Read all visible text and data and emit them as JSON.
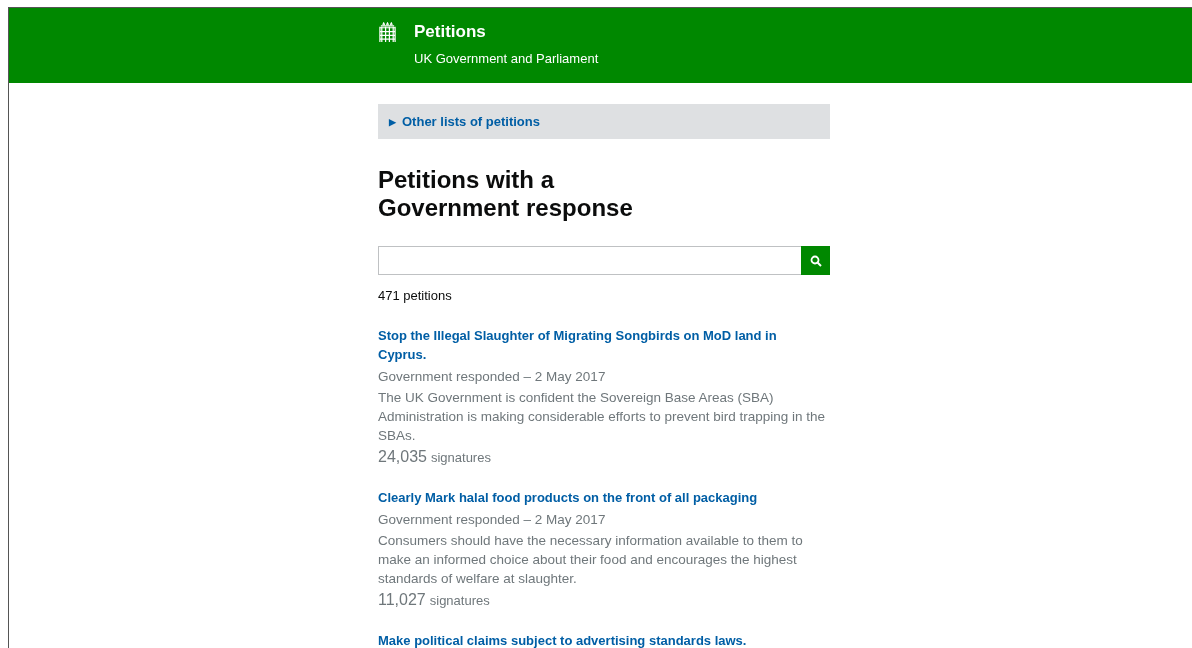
{
  "header": {
    "title": "Petitions",
    "subtitle": "UK Government and Parliament"
  },
  "other_lists": {
    "marker": "▶",
    "label": "Other lists of petitions",
    "expanded": false
  },
  "heading": "Petitions with a Government response",
  "count": "471 petitions",
  "petitions": [
    {
      "title": "Stop the Illegal Slaughter of Migrating Songbirds on MoD land in Cyprus.",
      "status": "Government responded – 2 May 2017",
      "summary": "The UK Government is confident the Sovereign Base Areas (SBA) Administration is making considerable efforts to prevent bird trapping in the SBAs.",
      "signatures": "24,035",
      "signatures_label": "signatures"
    },
    {
      "title": "Clearly Mark halal food products on the front of all packaging",
      "status": "Government responded – 2 May 2017",
      "summary": "Consumers should have the necessary information available to them to make an informed choice about their food and encourages the highest standards of welfare at slaughter.",
      "signatures": "11,027",
      "signatures_label": "signatures"
    },
    {
      "title": "Make political claims subject to advertising standards laws."
    }
  ]
}
